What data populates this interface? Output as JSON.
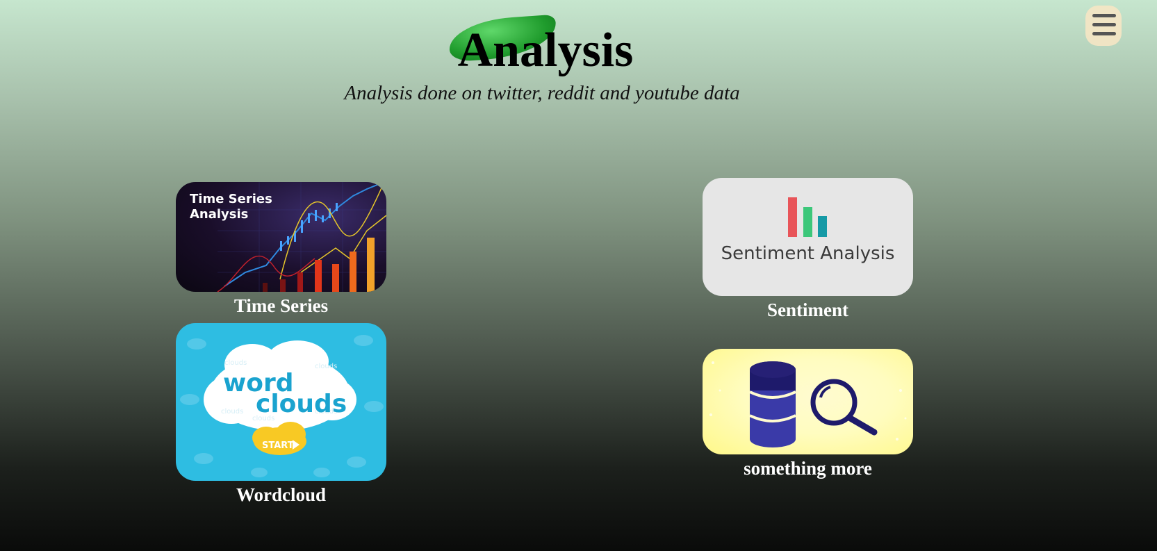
{
  "header": {
    "title": "Analysis",
    "subtitle": "Analysis done on twitter, reddit and youtube data"
  },
  "menu": {
    "icon": "hamburger-menu-icon"
  },
  "cards": {
    "time_series": {
      "label": "Time Series",
      "image_text": "Time Series Analysis",
      "image_line1": "Time Series",
      "image_line2": "Analysis"
    },
    "sentiment": {
      "label": "Sentiment",
      "image_text": "Sentiment Analysis"
    },
    "wordcloud": {
      "label": "Wordcloud",
      "image_word1": "word",
      "image_word2": "clouds",
      "image_button": "START"
    },
    "more": {
      "label": "something more"
    }
  },
  "colors": {
    "accent_green": "#1f9b2c",
    "wordcloud_blue": "#2ebde2",
    "sentiment_bg": "#e6e6e6",
    "more_bg": "#fff889",
    "navy": "#1e1a6b"
  }
}
